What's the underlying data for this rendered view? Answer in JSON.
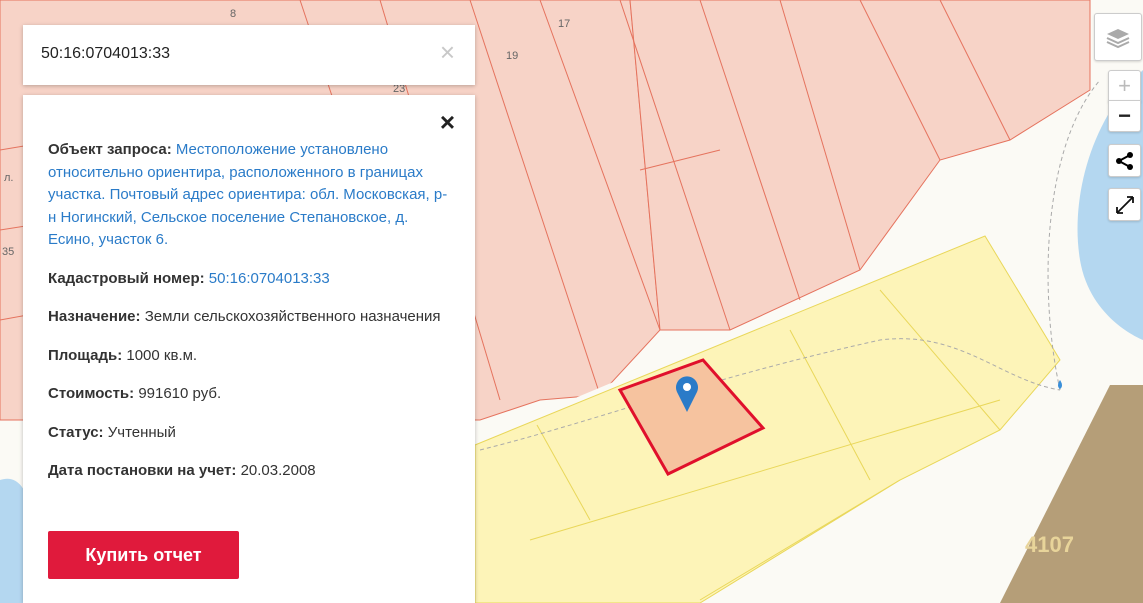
{
  "search": {
    "value": "50:16:0704013:33",
    "clear_icon": "×"
  },
  "card": {
    "close_icon": "×",
    "rows": [
      {
        "label": "Объект запроса:",
        "value": "Местоположение установлено относительно ориентира, расположенного в границах участка. Почтовый адрес ориентира: обл. Московская, р-н Ногинский, Сельское поселение Степановское, д. Есино, участок 6.",
        "link": true
      },
      {
        "label": "Кадастровый номер:",
        "value": "50:16:0704013:33",
        "link": true
      },
      {
        "label": "Назначение:",
        "value": "Земли сельскохозяйственного назначения",
        "link": false
      },
      {
        "label": "Площадь:",
        "value": "1000 кв.м.",
        "link": false
      },
      {
        "label": "Стоимость:",
        "value": "991610 руб.",
        "link": false
      },
      {
        "label": "Статус:",
        "value": "Учтенный",
        "link": false
      },
      {
        "label": "Дата постановки на учет:",
        "value": "20.03.2008",
        "link": false
      }
    ],
    "buy_label": "Купить отчет"
  },
  "map": {
    "labels": [
      "8",
      "17",
      "19",
      "23",
      "35",
      "л."
    ],
    "watermark": "4107",
    "controls": {
      "zoom_in": "+",
      "zoom_out": "−"
    }
  },
  "colors": {
    "accent": "#e01a3c",
    "link": "#2a7bc8",
    "selected_stroke": "#e0102c"
  }
}
